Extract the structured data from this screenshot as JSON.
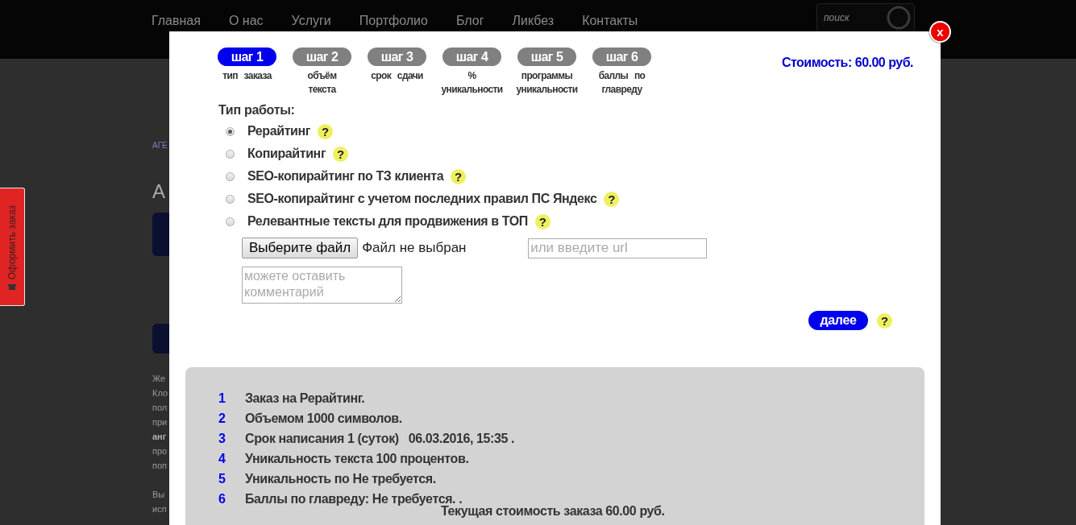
{
  "background_page": {
    "nav": [
      "Главная",
      "О нас",
      "Услуги",
      "Портфолио",
      "Блог",
      "Ликбез",
      "Контакты"
    ],
    "search": {
      "placeholder": "поиск"
    },
    "side_tab": "Оформить заказ",
    "breadcrumb": "АГЕ",
    "heading": "А",
    "text_fragments": [
      "Же",
      "Кло",
      "пол",
      "при",
      "анг",
      "про",
      "поп"
    ],
    "text_fragments_2": [
      "Вы",
      "исп"
    ]
  },
  "modal": {
    "close": "x",
    "steps": [
      {
        "label": "шаг 1",
        "caption": "тип заказа",
        "selected": true
      },
      {
        "label": "шаг 2",
        "caption": "объём текста",
        "selected": false
      },
      {
        "label": "шаг 3",
        "caption": "срок сдачи",
        "selected": false
      },
      {
        "label": "шаг 4",
        "caption": "% уникальности",
        "selected": false
      },
      {
        "label": "шаг 5",
        "caption": "программы уникальности",
        "selected": false
      },
      {
        "label": "шаг 6",
        "caption": "баллы по главреду",
        "selected": false
      }
    ],
    "price": "Стоимость: 60.00 руб.",
    "work_type_label": "Тип работы:",
    "work_types": [
      {
        "label": "Рерайтинг",
        "help": "?",
        "selected": true
      },
      {
        "label": "Копирайтинг",
        "help": "?",
        "selected": false
      },
      {
        "label": "SEO-копирайтинг по ТЗ клиента",
        "help": "?",
        "selected": false
      },
      {
        "label": "SEO-копирайтинг с учетом последних правил ПС Яндекс",
        "help": "?",
        "selected": false
      },
      {
        "label": "Релевантные тексты для продвижения в ТОП",
        "help": "?",
        "selected": false
      }
    ],
    "file_button": "Выберите файл",
    "file_status": "Файл не выбран",
    "url_field": {
      "placeholder": "или введите url"
    },
    "comment_field": {
      "placeholder": "можете оставить комментарий"
    },
    "next_button": "далее",
    "next_help": "?",
    "summary": [
      {
        "number": "1",
        "text": "Заказ на Рерайтинг."
      },
      {
        "number": "2",
        "text": "Объемом 1000 символов."
      },
      {
        "number": "3",
        "text": "Срок написания 1 (суток)   06.03.2016, 15:35 ."
      },
      {
        "number": "4",
        "text": "Уникальность текста 100 процентов."
      },
      {
        "number": "5",
        "text": "Уникальность по Не требуется."
      },
      {
        "number": "6",
        "text": "Баллы по главреду: Не требуется. ."
      }
    ],
    "total": "Текущая стоимость заказа 60.00 руб."
  }
}
